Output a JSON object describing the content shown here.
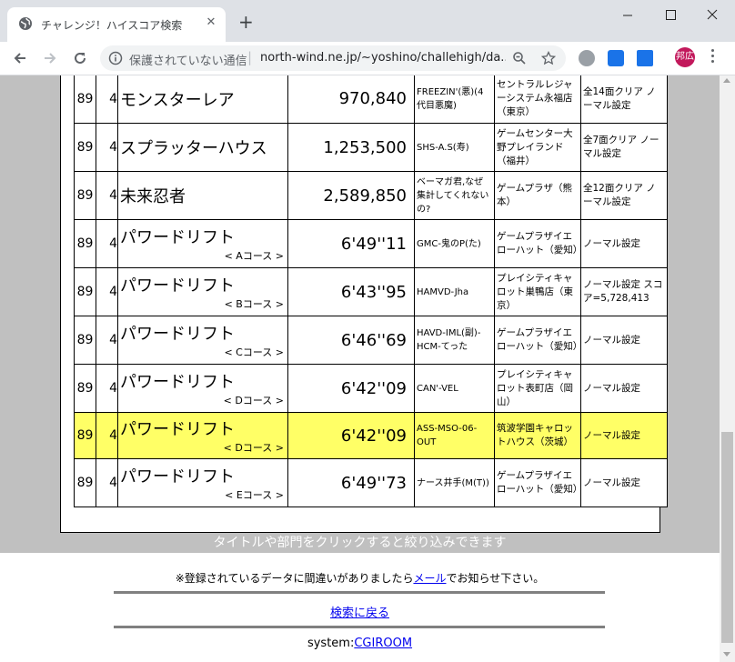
{
  "browser": {
    "tab_title": "チャレンジ！ハイスコア検索",
    "tab_close": "✕",
    "new_tab": "+",
    "security_label": "保護されていない通信",
    "url": "north-wind.ne.jp/~yoshino/challehigh/da...",
    "profile_initials": "邦広",
    "colors": {
      "profile": "#c2185b",
      "ext_blue": "#1a73e8",
      "ext_gray": "#9aa0a6"
    }
  },
  "table": {
    "rows": [
      {
        "rank": "89",
        "num": "4",
        "title": "モンスターレア",
        "course": "",
        "score": "970,840",
        "name": "FREEZIN'(悪)(4代目悪魔)",
        "shop": "セントラルレジャーシステム永福店（東京）",
        "note": "全14面クリア ノーマル設定",
        "highlight": false
      },
      {
        "rank": "89",
        "num": "4",
        "title": "スプラッターハウス",
        "course": "",
        "score": "1,253,500",
        "name": "SHS-A.S(寿)",
        "shop": "ゲームセンター大野プレイランド（福井）",
        "note": "全7面クリア ノーマル設定",
        "highlight": false
      },
      {
        "rank": "89",
        "num": "4",
        "title": "未来忍者",
        "course": "",
        "score": "2,589,850",
        "name": "ベーマガ君,なぜ集計してくれないの?",
        "shop": "ゲームプラザ（熊本）",
        "note": "全12面クリア ノーマル設定",
        "highlight": false
      },
      {
        "rank": "89",
        "num": "4",
        "title": "パワードリフト",
        "course": "< Aコース >",
        "score": "6'49''11",
        "name": "GMC-鬼のP(た)",
        "shop": "ゲームプラザイエローハット（愛知）",
        "note": "ノーマル設定",
        "highlight": false
      },
      {
        "rank": "89",
        "num": "4",
        "title": "パワードリフト",
        "course": "< Bコース >",
        "score": "6'43''95",
        "name": "HAMVD-Jha",
        "shop": "プレイシティキャロット巣鴨店（東京）",
        "note": "ノーマル設定 スコア=5,728,413",
        "highlight": false
      },
      {
        "rank": "89",
        "num": "4",
        "title": "パワードリフト",
        "course": "< Cコース >",
        "score": "6'46''69",
        "name": "HAVD-IML(副)-HCM-てった",
        "shop": "ゲームプラザイエローハット（愛知）",
        "note": "ノーマル設定",
        "highlight": false
      },
      {
        "rank": "89",
        "num": "4",
        "title": "パワードリフト",
        "course": "< Dコース >",
        "score": "6'42''09",
        "name": "CAN'-VEL",
        "shop": "プレイシティキャロット表町店（岡山）",
        "note": "ノーマル設定",
        "highlight": false
      },
      {
        "rank": "89",
        "num": "4",
        "title": "パワードリフト",
        "course": "< Dコース >",
        "score": "6'42''09",
        "name": "ASS-MSO-06-OUT",
        "shop": "筑波学園キャロットハウス（茨城）",
        "note": "ノーマル設定",
        "highlight": true
      },
      {
        "rank": "89",
        "num": "4",
        "title": "パワードリフト",
        "course": "< Eコース >",
        "score": "6'49''73",
        "name": "ナース井手(M(T))",
        "shop": "ゲームプラザイエローハット（愛知）",
        "note": "ノーマル設定",
        "highlight": false
      }
    ],
    "highlight_color": "#ffff66"
  },
  "footer": {
    "filter_hint": "タイトルや部門をクリックすると絞り込みできます",
    "note_prefix": "※登録されているデータに間違いがありましたら",
    "mail_link": "メール",
    "note_suffix": "でお知らせ下さい。",
    "back_link": "検索に戻る",
    "system_label": "system:",
    "system_link": "CGIROOM"
  }
}
